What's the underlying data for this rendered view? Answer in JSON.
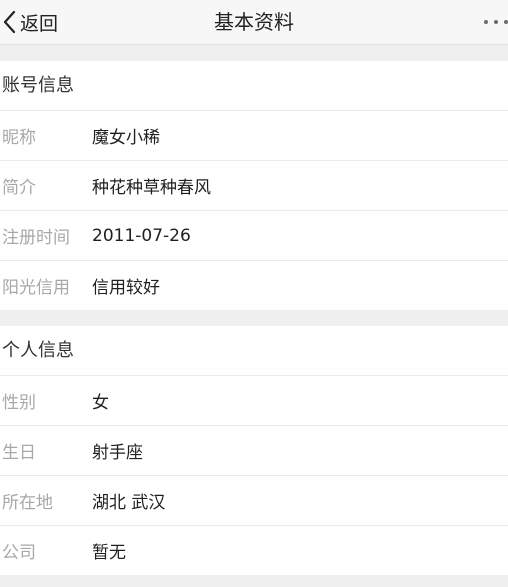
{
  "nav": {
    "back_label": "返回",
    "title": "基本资料",
    "more_icon": "more-horizontal-icon",
    "back_icon": "chevron-left-icon"
  },
  "account": {
    "header": "账号信息",
    "rows": [
      {
        "label": "昵称",
        "value": "魔女小稀"
      },
      {
        "label": "简介",
        "value": "种花种草种春风"
      },
      {
        "label": "注册时间",
        "value": "2011-07-26"
      },
      {
        "label": "阳光信用",
        "value": "信用较好"
      }
    ]
  },
  "personal": {
    "header": "个人信息",
    "rows": [
      {
        "label": "性别",
        "value": "女"
      },
      {
        "label": "生日",
        "value": "射手座"
      },
      {
        "label": "所在地",
        "value": "湖北 武汉"
      },
      {
        "label": "公司",
        "value": "暂无"
      }
    ]
  },
  "colors": {
    "background": "#ffffff",
    "section_gap": "#efefef",
    "label": "#a8a8a8",
    "value": "#1f1f1f"
  }
}
